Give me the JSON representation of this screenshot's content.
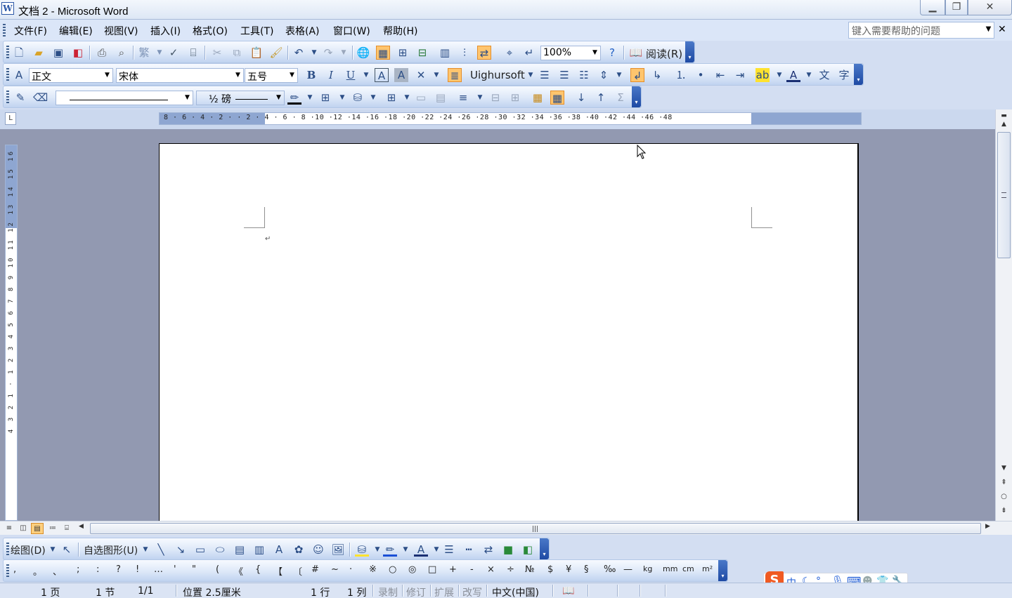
{
  "window": {
    "title": "文档 2 - Microsoft Word",
    "min_icon": "minimize-icon",
    "max_icon": "restore-icon",
    "close_icon": "close-icon"
  },
  "menu": {
    "items": [
      "文件(F)",
      "编辑(E)",
      "视图(V)",
      "插入(I)",
      "格式(O)",
      "工具(T)",
      "表格(A)",
      "窗口(W)",
      "帮助(H)"
    ],
    "help_placeholder": "键入需要帮助的问题"
  },
  "standard_toolbar": {
    "zoom": "100%",
    "read_label": "阅读(R)"
  },
  "format_toolbar": {
    "style": "正文",
    "font": "宋体",
    "size": "五号",
    "complex_font": "Uighursoft"
  },
  "table_toolbar": {
    "line_weight": "½ 磅"
  },
  "ruler": {
    "h_ticks": "8 · 6 · 4 · 2 ·   · 2 · 4 · 6 · 8 ·10 ·12 ·14 ·16 ·18 ·20 ·22 ·24 ·26 ·28 ·30 ·32 ·34 ·36 ·38 ·40 ·42 ·44 ·46 ·48",
    "v_ticks": "4 3 2 1 · 1 2 3 4 5 6 7 8 9 10 11 12 13 14 15 16",
    "corner": "L"
  },
  "document": {
    "paragraph_mark": "↵"
  },
  "draw_toolbar": {
    "draw_label": "绘图(D)",
    "autoshape_label": "自选图形(U)"
  },
  "symbols": [
    ",",
    "。",
    "、",
    ";",
    ":",
    "?",
    "!",
    "…",
    "'",
    "\"",
    "(",
    "《",
    "{",
    "【",
    "〔",
    "#",
    "~",
    "·",
    "※",
    "○",
    "◎",
    "□",
    "+",
    "-",
    "×",
    "÷",
    "№",
    "$",
    "¥",
    "§",
    "‰",
    "—",
    "kg",
    "mm",
    "cm",
    "m²"
  ],
  "ime": {
    "logo": "S",
    "mode": "中"
  },
  "status": {
    "page": "1 页",
    "section": "1 节",
    "page_count": "1/1",
    "position": "位置 2.5厘米",
    "line": "1 行",
    "column": "1 列",
    "rec": "录制",
    "trk": "修订",
    "ext": "扩展",
    "ovr": "改写",
    "language": "中文(中国)"
  },
  "colors": {
    "accent": "#ffc56e",
    "workspace": "#9299b1",
    "toolbar": "#c3d4ef"
  }
}
